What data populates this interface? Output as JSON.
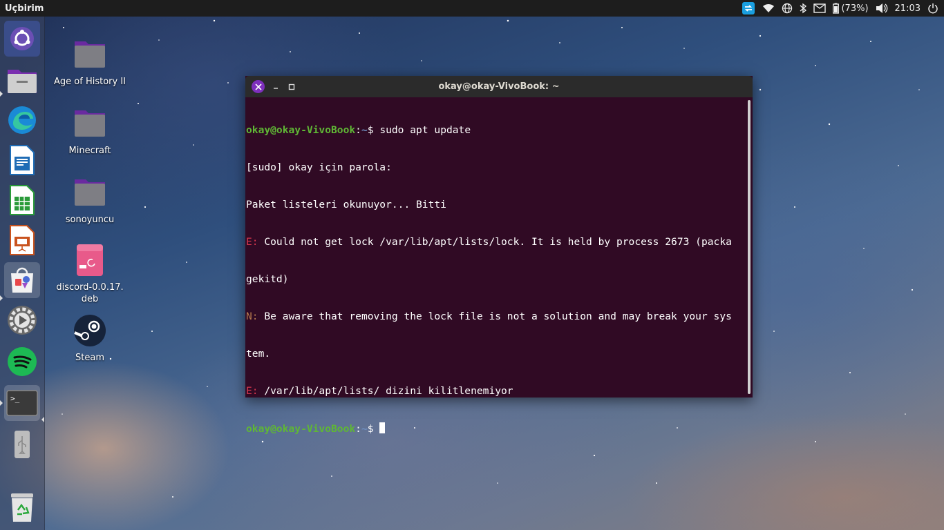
{
  "top_panel": {
    "app_name": "Uçbirim",
    "battery_text": "(73%)",
    "clock": "21:03"
  },
  "launcher": {
    "items": [
      {
        "name": "dash",
        "icon": "ubuntu-logo-icon"
      },
      {
        "name": "files",
        "icon": "file-manager-icon"
      },
      {
        "name": "edge",
        "icon": "edge-browser-icon"
      },
      {
        "name": "writer",
        "icon": "libreoffice-writer-icon"
      },
      {
        "name": "calc",
        "icon": "libreoffice-calc-icon"
      },
      {
        "name": "impress",
        "icon": "libreoffice-impress-icon"
      },
      {
        "name": "software",
        "icon": "software-center-icon"
      },
      {
        "name": "settings",
        "icon": "settings-icon"
      },
      {
        "name": "spotify",
        "icon": "spotify-icon"
      },
      {
        "name": "terminal",
        "icon": "terminal-icon"
      },
      {
        "name": "usb",
        "icon": "usb-drive-icon"
      },
      {
        "name": "trash",
        "icon": "trash-icon"
      }
    ]
  },
  "desktop": {
    "icons": [
      {
        "label": "Age of History II",
        "icon": "folder-icon"
      },
      {
        "label": "Minecraft",
        "icon": "folder-icon"
      },
      {
        "label": "sonoyuncu",
        "icon": "folder-icon"
      },
      {
        "label_line1": "discord-0.0.17.",
        "label_line2": "deb",
        "icon": "deb-package-icon"
      },
      {
        "label": "Steam",
        "icon": "steam-icon"
      }
    ]
  },
  "terminal": {
    "title": "okay@okay-VivoBook: ~",
    "prompt_user": "okay@okay-VivoBook",
    "prompt_path": "~",
    "prompt_colon": ":",
    "prompt_symbol": "$ ",
    "command": "sudo apt update",
    "line_sudo": "[sudo] okay için parola:",
    "line_reading": "Paket listeleri okunuyor... Bitti",
    "err1_tag": "E: ",
    "err1_text_a": "Could not get lock /var/lib/apt/lists/lock. It is held by process 2673 (packa",
    "err1_text_b": "gekitd)",
    "note_tag": "N: ",
    "note_text_a": "Be aware that removing the lock file is not a solution and may break your sys",
    "note_text_b": "tem.",
    "err2_tag": "E: ",
    "err2_text": "/var/lib/apt/lists/ dizini kilitlenemiyor"
  },
  "colors": {
    "terminal_bg": "#300a24",
    "prompt_green": "#5fb735",
    "prompt_blue": "#6f8fc0",
    "error_red": "#d7374e",
    "note_brown": "#b3774d",
    "close_button": "#7e2fbd"
  }
}
